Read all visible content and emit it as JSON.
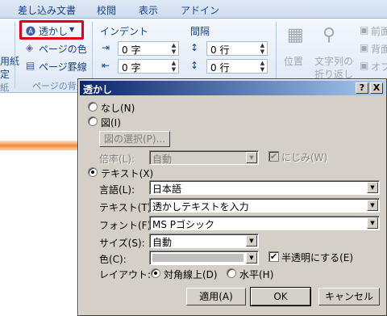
{
  "ribbon": {
    "tabs": [
      "差し込み文書",
      "校閲",
      "表示",
      "アドイン"
    ],
    "watermark_button": "透かし",
    "page_color": "ページの色",
    "page_border": "ページ罫線",
    "group_page_bg": "ページの背景",
    "left_partial_1": "用紙",
    "left_partial_2": "定",
    "left_partial_3": "紙",
    "indent_label": "インデント",
    "spacing_label": "間隔",
    "indent_left": "0 字",
    "indent_right": "0 字",
    "spacing_before": "0 行",
    "spacing_after": "0 行",
    "position_label": "位置",
    "wrap_label_1": "文字列の",
    "wrap_label_2": "折り返し",
    "front_partial": "前面",
    "back_partial": "背面",
    "obj_partial": "オブ"
  },
  "dialog": {
    "title": "透かし",
    "help_btn": "?",
    "close_btn": "X",
    "none_label": "なし(N)",
    "picture_label": "図(I)",
    "select_picture": "図の選択(P)...",
    "scale_label": "倍率(L):",
    "scale_value": "自動",
    "washout_label": "にじみ(W)",
    "text_label": "テキスト(X)",
    "language_label": "言語(L):",
    "language_value": "日本語",
    "text_field_label": "テキスト(T):",
    "text_value": "透かしテキストを入力",
    "font_label": "フォント(F):",
    "font_value": "MS Pゴシック",
    "size_label": "サイズ(S):",
    "size_value": "自動",
    "color_label": "色(C):",
    "semitransparent_label": "半透明にする(E)",
    "layout_label": "レイアウト:",
    "diagonal_label": "対角線上(D)",
    "horizontal_label": "水平(H)",
    "apply_btn": "適用(A)",
    "ok_btn": "OK",
    "cancel_btn": "キャンセル"
  }
}
